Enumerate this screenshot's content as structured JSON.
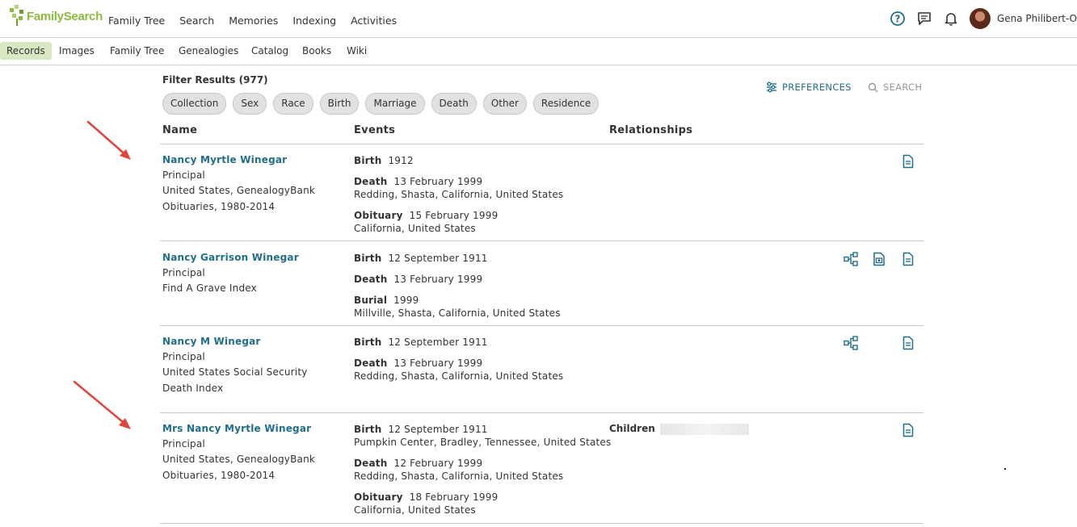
{
  "header": {
    "logo_text": "FamilySearch",
    "nav": [
      "Family Tree",
      "Search",
      "Memories",
      "Indexing",
      "Activities"
    ],
    "user_name": "Gena Philibert-O"
  },
  "subnav": [
    "Records",
    "Images",
    "Family Tree",
    "Genealogies",
    "Catalog",
    "Books",
    "Wiki"
  ],
  "filters": {
    "title": "Filter Results (977)",
    "chips": [
      "Collection",
      "Sex",
      "Race",
      "Birth",
      "Marriage",
      "Death",
      "Other",
      "Residence"
    ],
    "preferences": "PREFERENCES",
    "search": "SEARCH"
  },
  "columns": {
    "name": "Name",
    "events": "Events",
    "relationships": "Relationships"
  },
  "results": [
    {
      "name": "Nancy Myrtle Winegar",
      "role": "Principal",
      "collection": "United States, GenealogyBank Obituaries, 1980-2014",
      "events": [
        {
          "type": "Birth",
          "date": "1912",
          "place": ""
        },
        {
          "type": "Death",
          "date": "13 February 1999",
          "place": "Redding, Shasta, California, United States"
        },
        {
          "type": "Obituary",
          "date": "15 February 1999",
          "place": "California, United States"
        }
      ]
    },
    {
      "name": "Nancy Garrison Winegar",
      "role": "Principal",
      "collection": "Find A Grave Index",
      "events": [
        {
          "type": "Birth",
          "date": "12 September 1911",
          "place": ""
        },
        {
          "type": "Death",
          "date": "13 February 1999",
          "place": ""
        },
        {
          "type": "Burial",
          "date": "1999",
          "place": "Millville, Shasta, California, United States"
        }
      ]
    },
    {
      "name": "Nancy M Winegar",
      "role": "Principal",
      "collection": "United States Social Security Death Index",
      "events": [
        {
          "type": "Birth",
          "date": "12 September 1911",
          "place": ""
        },
        {
          "type": "Death",
          "date": "13 February 1999",
          "place": "Redding, Shasta, California, United States"
        }
      ]
    },
    {
      "name": "Mrs Nancy Myrtle Winegar",
      "role": "Principal",
      "collection": "United States, GenealogyBank Obituaries, 1980-2014",
      "events": [
        {
          "type": "Birth",
          "date": "12 September 1911",
          "place": "Pumpkin Center, Bradley, Tennessee, United States"
        },
        {
          "type": "Death",
          "date": "12 February 1999",
          "place": "Redding, Shasta, California, United States"
        },
        {
          "type": "Obituary",
          "date": "18 February 1999",
          "place": "California, United States"
        }
      ],
      "relationship_label": "Children"
    }
  ],
  "colors": {
    "link": "#1f6e8c",
    "brand_green": "#8dbb3e",
    "active_tab_bg": "#d7e8c3",
    "annotation_arrow": "#e0443a"
  }
}
